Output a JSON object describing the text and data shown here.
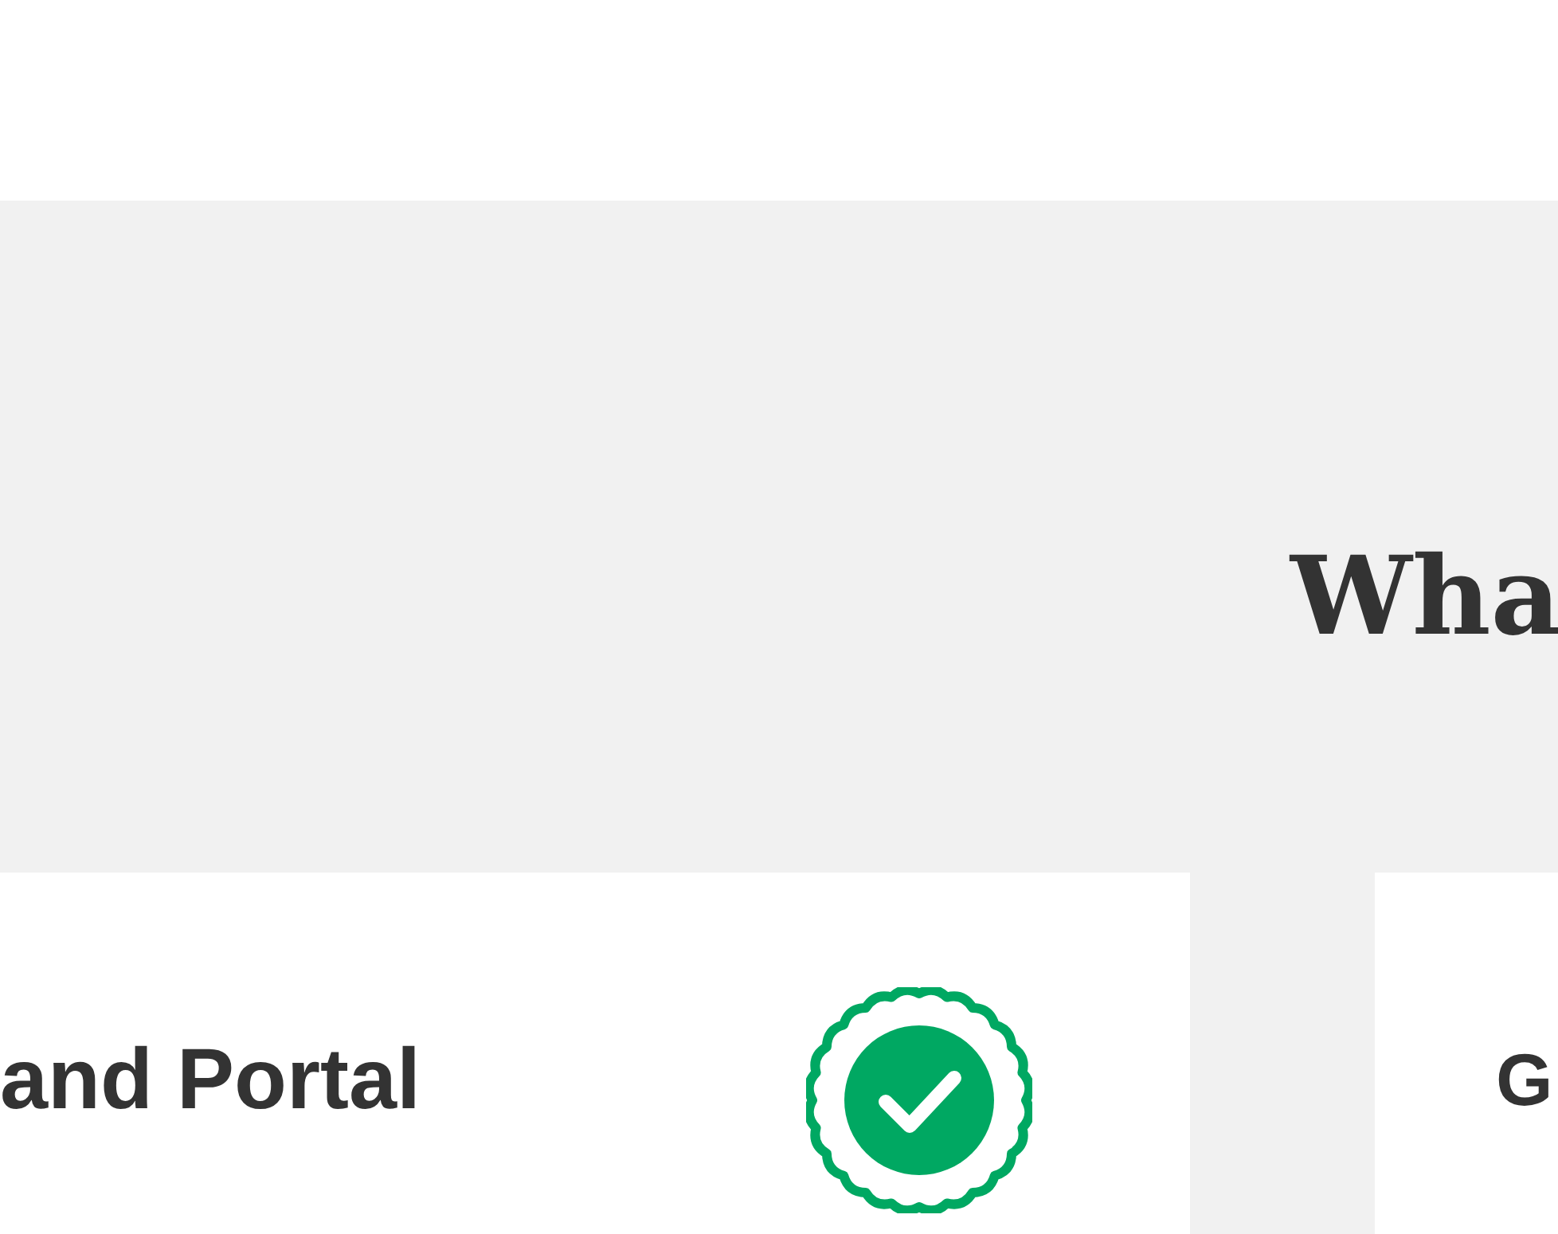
{
  "heading": "Wha",
  "cards": [
    {
      "title": "and Portal",
      "verified": true
    },
    {
      "title": "G"
    }
  ]
}
